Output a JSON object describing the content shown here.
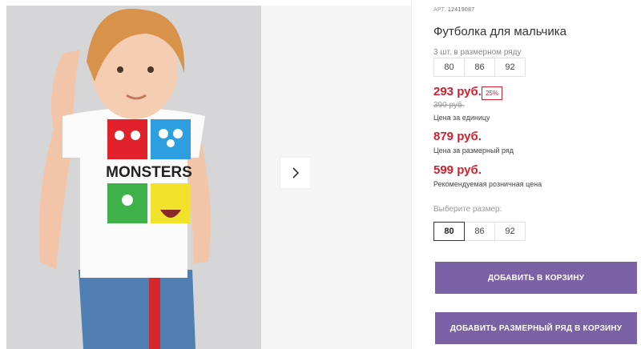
{
  "product": {
    "sku_label": "АРТ.",
    "sku": "12419087",
    "title": "Футболка для мальчика",
    "range_label": "3 шт. в размерном ряду",
    "range_sizes": [
      "80",
      "86",
      "92"
    ],
    "price": "293 руб.",
    "discount": "25%",
    "old_price": "390 руб.",
    "unit_price_label": "Цена за единицу",
    "range_price": "879 руб.",
    "range_price_label": "Цена за размерный ряд",
    "retail_price": "599 руб.",
    "retail_price_label": "Рекомендуемая розничная цена",
    "select_size_label": "Выберите размер:",
    "size_options": [
      "80",
      "86",
      "92"
    ],
    "selected_size": "80",
    "add_to_cart_label": "ДОБАВИТЬ В КОРЗИНУ",
    "add_range_to_cart_label": "ДОБАВИТЬ РАЗМЕРНЫЙ РЯД В КОРЗИНУ"
  },
  "gallery": {
    "next_icon": "chevron-right-icon",
    "tshirt_print_text": "MONSTERS"
  },
  "colors": {
    "accent": "#7b62a6",
    "price_red": "#d2202e"
  }
}
